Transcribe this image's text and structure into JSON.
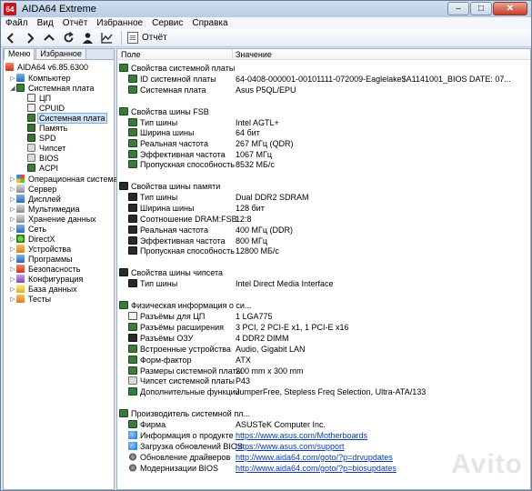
{
  "window": {
    "title": "AIDA64 Extreme",
    "app_icon_text": "64"
  },
  "title_buttons": {
    "minimize": "–",
    "maximize": "□",
    "close": "✕"
  },
  "menu": [
    {
      "label": "Файл"
    },
    {
      "label": "Вид"
    },
    {
      "label": "Отчёт"
    },
    {
      "label": "Избранное"
    },
    {
      "label": "Сервис"
    },
    {
      "label": "Справка"
    }
  ],
  "toolbar": {
    "report_label": "Отчёт"
  },
  "left": {
    "tabs": [
      {
        "label": "Меню"
      },
      {
        "label": "Избранное"
      }
    ],
    "root_label": "AIDA64 v6.85.6300",
    "tree": [
      {
        "label": "Компьютер",
        "icon": "computer-icon"
      },
      {
        "label": "Системная плата",
        "icon": "motherboard-icon"
      },
      {
        "label": "ЦП",
        "icon": "cpu-icon"
      },
      {
        "label": "CPUID",
        "icon": "cpuid-icon"
      },
      {
        "label": "Системная плата",
        "icon": "motherboard-icon"
      },
      {
        "label": "Память",
        "icon": "memory-icon"
      },
      {
        "label": "SPD",
        "icon": "spd-icon"
      },
      {
        "label": "Чипсет",
        "icon": "chipset-icon"
      },
      {
        "label": "BIOS",
        "icon": "bios-icon"
      },
      {
        "label": "ACPI",
        "icon": "acpi-icon"
      },
      {
        "label": "Операционная система",
        "icon": "windows-icon"
      },
      {
        "label": "Сервер",
        "icon": "server-icon"
      },
      {
        "label": "Дисплей",
        "icon": "display-icon"
      },
      {
        "label": "Мультимедиа",
        "icon": "multimedia-icon"
      },
      {
        "label": "Хранение данных",
        "icon": "storage-icon"
      },
      {
        "label": "Сеть",
        "icon": "network-icon"
      },
      {
        "label": "DirectX",
        "icon": "directx-icon"
      },
      {
        "label": "Устройства",
        "icon": "devices-icon"
      },
      {
        "label": "Программы",
        "icon": "programs-icon"
      },
      {
        "label": "Безопасность",
        "icon": "security-icon"
      },
      {
        "label": "Конфигурация",
        "icon": "config-icon"
      },
      {
        "label": "База данных",
        "icon": "database-icon"
      },
      {
        "label": "Тесты",
        "icon": "tests-icon"
      }
    ]
  },
  "columns": {
    "field": "Поле",
    "value": "Значение"
  },
  "rows": [
    {
      "field": "Свойства системной платы",
      "value": ""
    },
    {
      "field": "ID системной платы",
      "value": "64-0408-000001-00101111-072009-Eaglelake$A1141001_BIOS DATE: 07..."
    },
    {
      "field": "Системная плата",
      "value": "Asus P5QL/EPU"
    },
    {
      "field": "Свойства шины FSB",
      "value": ""
    },
    {
      "field": "Тип шины",
      "value": "Intel AGTL+"
    },
    {
      "field": "Ширина шины",
      "value": "64 бит"
    },
    {
      "field": "Реальная частота",
      "value": "267 МГц (QDR)"
    },
    {
      "field": "Эффективная частота",
      "value": "1067 МГц"
    },
    {
      "field": "Пропускная способность",
      "value": "8532 МБ/с"
    },
    {
      "field": "Свойства шины памяти",
      "value": ""
    },
    {
      "field": "Тип шины",
      "value": "Dual DDR2 SDRAM"
    },
    {
      "field": "Ширина шины",
      "value": "128 бит"
    },
    {
      "field": "Соотношение DRAM:FSB",
      "value": "12:8"
    },
    {
      "field": "Реальная частота",
      "value": "400 МГц (DDR)"
    },
    {
      "field": "Эффективная частота",
      "value": "800 МГц"
    },
    {
      "field": "Пропускная способность",
      "value": "12800 МБ/с"
    },
    {
      "field": "Свойства шины чипсета",
      "value": ""
    },
    {
      "field": "Тип шины",
      "value": "Intel Direct Media Interface"
    },
    {
      "field": "Физическая информация о си...",
      "value": ""
    },
    {
      "field": "Разъёмы для ЦП",
      "value": "1 LGA775"
    },
    {
      "field": "Разъёмы расширения",
      "value": "3 PCI, 2 PCI-E x1, 1 PCI-E x16"
    },
    {
      "field": "Разъёмы ОЗУ",
      "value": "4 DDR2 DIMM"
    },
    {
      "field": "Встроенные устройства",
      "value": "Audio, Gigabit LAN"
    },
    {
      "field": "Форм-фактор",
      "value": "ATX"
    },
    {
      "field": "Размеры системной платы",
      "value": "200 mm x 300 mm"
    },
    {
      "field": "Чипсет системной платы",
      "value": "P43"
    },
    {
      "field": "Дополнительные функции",
      "value": "JumperFree, Stepless Freq Selection, Ultra-ATA/133"
    },
    {
      "field": "Производитель системной пл...",
      "value": ""
    },
    {
      "field": "Фирма",
      "value": "ASUSTeK Computer Inc."
    },
    {
      "field": "Информация о продукте",
      "value": "https://www.asus.com/Motherboards"
    },
    {
      "field": "Загрузка обновлений BIOS",
      "value": "https://www.asus.com/support"
    },
    {
      "field": "Обновление драйверов",
      "value": "http://www.aida64.com/goto/?p=drvupdates"
    },
    {
      "field": "Модернизации BIOS",
      "value": "http://www.aida64.com/goto/?p=biosupdates"
    }
  ],
  "watermark": "Avito"
}
